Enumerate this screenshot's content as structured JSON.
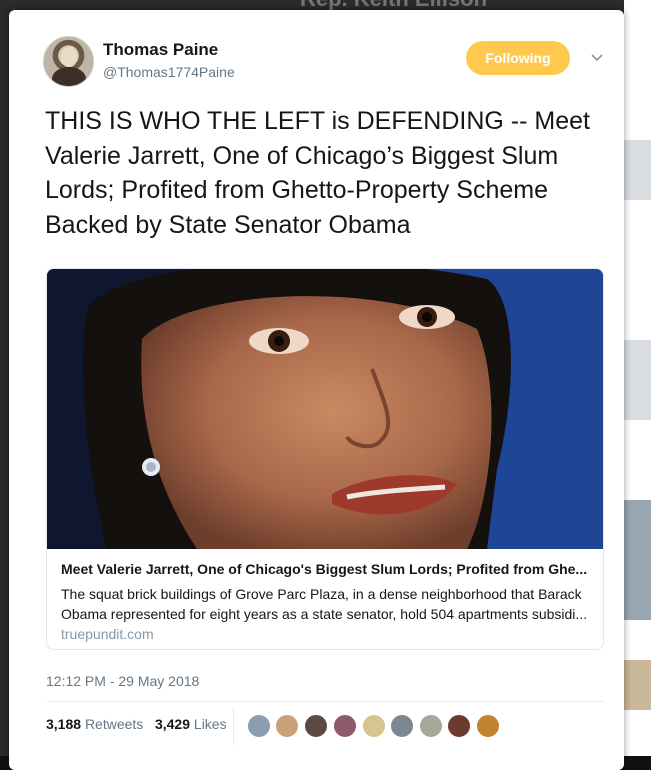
{
  "background": {
    "top_text": "Rep. Keith Ellison"
  },
  "tweet": {
    "author_name": "Thomas Paine",
    "author_handle": "@Thomas1774Paine",
    "follow_label": "Following",
    "text": "THIS IS WHO THE LEFT is DEFENDING -- Meet Valerie Jarrett, One of Chicago’s Biggest Slum Lords; Profited from Ghetto-Property Scheme Backed by State Senator Obama",
    "link_card": {
      "title": "Meet Valerie Jarrett, One of Chicago's Biggest Slum Lords; Profited from Ghe...",
      "description": "The squat brick buildings of Grove Parc Plaza, in a dense neighborhood that Barack Obama represented for eight years as a state senator, hold 504 apartments subsidi...",
      "domain": "truepundit.com"
    },
    "timestamp": "12:12 PM - 29 May 2018",
    "retweets_count": "3,188",
    "retweets_label": "Retweets",
    "likes_count": "3,429",
    "likes_label": "Likes"
  },
  "colors": {
    "follow_button": "#ffc94d",
    "secondary_text": "#657786"
  }
}
